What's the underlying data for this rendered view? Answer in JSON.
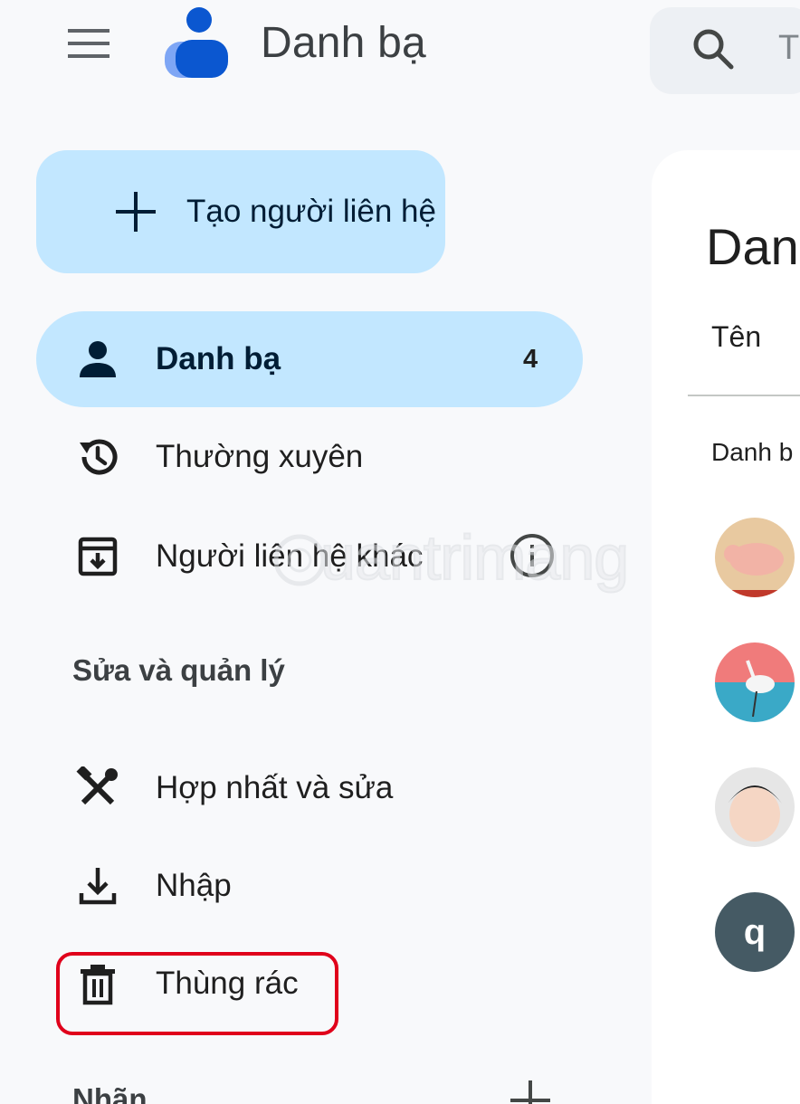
{
  "header": {
    "app_title": "Danh bạ",
    "search_placeholder": "T"
  },
  "sidebar": {
    "create_label": "Tạo người liên hệ",
    "items": [
      {
        "label": "Danh bạ",
        "count": "4",
        "icon": "person-icon",
        "active": true
      },
      {
        "label": "Thường xuyên",
        "icon": "history-icon"
      },
      {
        "label": "Người liên hệ khác",
        "icon": "archive-download-icon"
      }
    ],
    "manage_title": "Sửa và quản lý",
    "manage_items": [
      {
        "label": "Hợp nhất và sửa",
        "icon": "merge-fix-icon"
      },
      {
        "label": "Nhập",
        "icon": "download-icon"
      },
      {
        "label": "Thùng rác",
        "icon": "trash-icon"
      }
    ],
    "labels_title": "Nhãn"
  },
  "main": {
    "title": "Dan",
    "column_header": "Tên",
    "group_label": "Danh b",
    "contacts": [
      {
        "avatar": "pig-photo"
      },
      {
        "avatar": "bird-photo"
      },
      {
        "avatar": "child-photo"
      },
      {
        "avatar_letter": "q",
        "color": "#455a64"
      }
    ]
  },
  "watermark": {
    "text": "uantrimang"
  },
  "colors": {
    "accent_light": "#c2e7ff",
    "highlight_border": "#e0001b",
    "background": "#f8f9fb"
  }
}
